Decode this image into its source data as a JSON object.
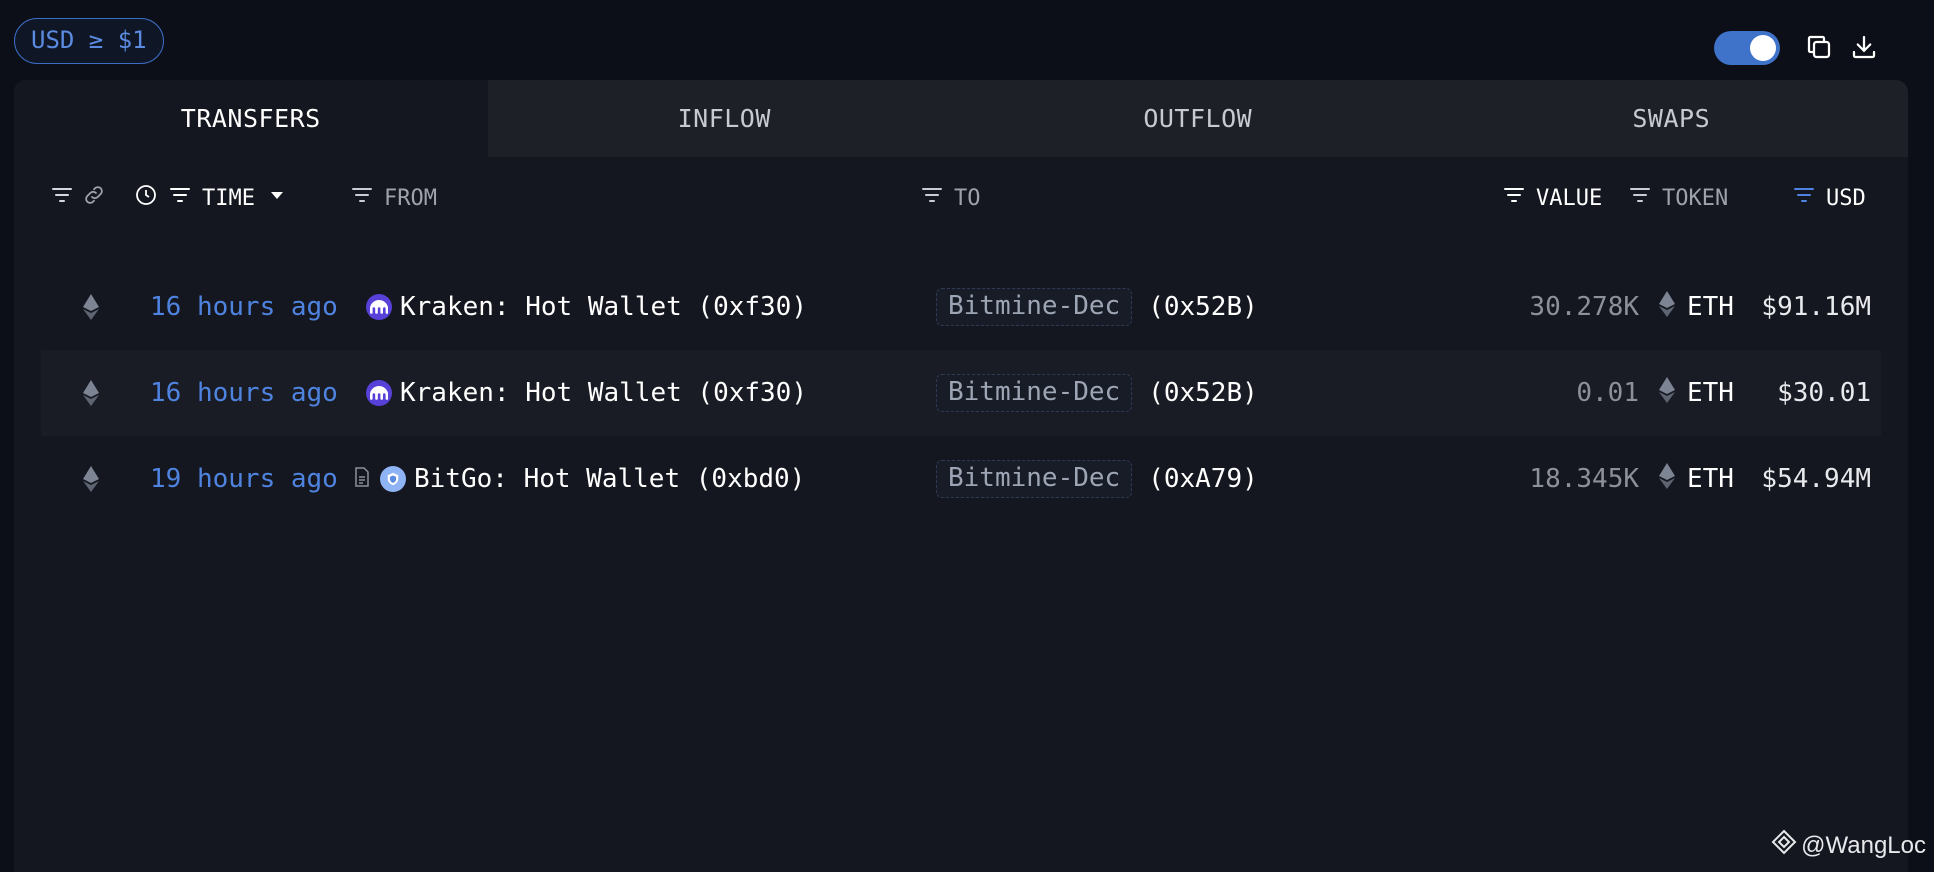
{
  "filter_chip": {
    "label": "USD ≥ $1"
  },
  "toggle": {
    "state": "on"
  },
  "tabs": [
    {
      "label": "TRANSFERS",
      "active": true
    },
    {
      "label": "INFLOW",
      "active": false
    },
    {
      "label": "OUTFLOW",
      "active": false
    },
    {
      "label": "SWAPS",
      "active": false
    }
  ],
  "columns": {
    "time": "TIME",
    "from": "FROM",
    "to": "TO",
    "value": "VALUE",
    "token": "TOKEN",
    "usd": "USD"
  },
  "rows": [
    {
      "chain_icon": "ethereum-icon",
      "time": "16 hours ago",
      "from": "Kraken: Hot Wallet (0xf30)",
      "from_icon": "kraken-icon",
      "to_tag": "Bitmine-Dec",
      "to_addr": "(0x52B)",
      "value": "30.278K",
      "token": "ETH",
      "usd": "$91.16M"
    },
    {
      "chain_icon": "ethereum-icon",
      "time": "16 hours ago",
      "from": "Kraken: Hot Wallet (0xf30)",
      "from_icon": "kraken-icon",
      "to_tag": "Bitmine-Dec",
      "to_addr": "(0x52B)",
      "value": "0.01",
      "token": "ETH",
      "usd": "$30.01"
    },
    {
      "chain_icon": "ethereum-icon",
      "time": "19 hours ago",
      "from": "BitGo: Hot Wallet (0xbd0)",
      "from_icon": "bitgo-icon",
      "to_tag": "Bitmine-Dec",
      "to_addr": "(0xA79)",
      "value": "18.345K",
      "token": "ETH",
      "usd": "$54.94M"
    }
  ],
  "watermark": {
    "text": "@WangLoc"
  },
  "colors": {
    "background": "#0c0f17",
    "panel": "#14171f",
    "accent": "#3f72c9",
    "time_link": "#4f83e0"
  }
}
